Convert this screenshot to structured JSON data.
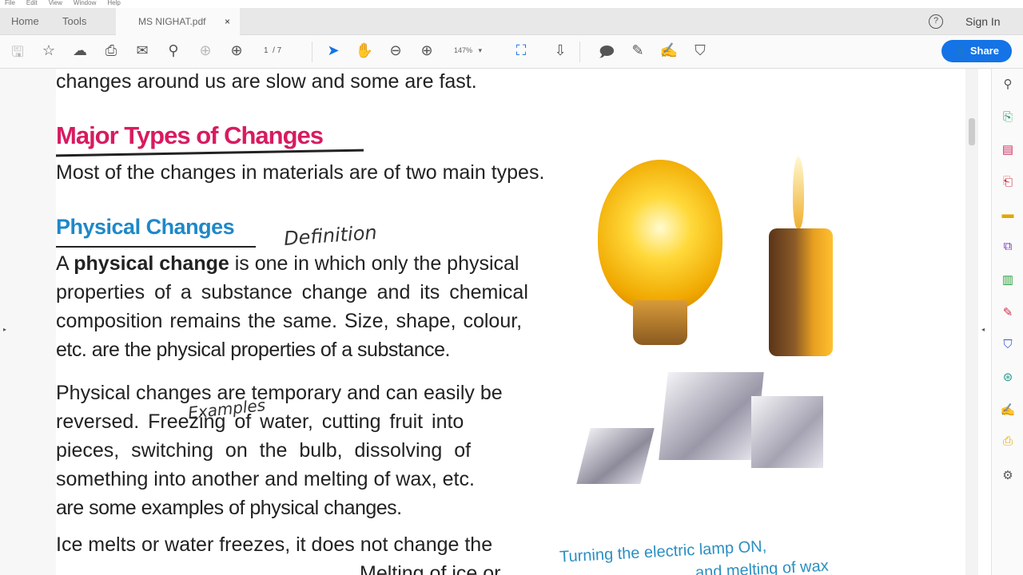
{
  "menu": [
    "File",
    "Edit",
    "View",
    "Window",
    "Help"
  ],
  "tabs": {
    "home": "Home",
    "tools": "Tools",
    "document": "MS NIGHAT.pdf",
    "close": "×"
  },
  "header": {
    "help": "?",
    "sign_in": "Sign In"
  },
  "toolbar": {
    "page_current": "1",
    "page_total": "/ 7",
    "zoom": "147%",
    "share": "Share"
  },
  "content": {
    "line0": "changes around us are slow and some are fast.",
    "heading_major": "Major Types of Changes",
    "line_major": "Most of the changes in materials are of two main types.",
    "heading_physical": "Physical Changes",
    "annotation_definition": "Definition",
    "def_bold": "physical change",
    "def_1a": "A",
    "def_1b": "is one in which only the physical",
    "def_2": "properties of a substance change and its chemical",
    "def_3": "composition remains the same. Size, shape, colour,",
    "def_4": "etc. are the physical properties of a substance.",
    "p2_1": "Physical changes are temporary and can easily be",
    "p2_2": "reversed. Freezing of water, cutting fruit into",
    "annotation_examples": "Examples",
    "p2_3": "pieces, switching on the bulb, dissolving of",
    "p2_4": "something into another and melting of wax, etc.",
    "p2_5": "are some examples of physical changes.",
    "p3_1": "Ice melts or water freezes, it does not change the",
    "p3_2": "Melting of ice or",
    "caption_1": "Turning the electric lamp ON,",
    "caption_2": "and melting of wax"
  }
}
